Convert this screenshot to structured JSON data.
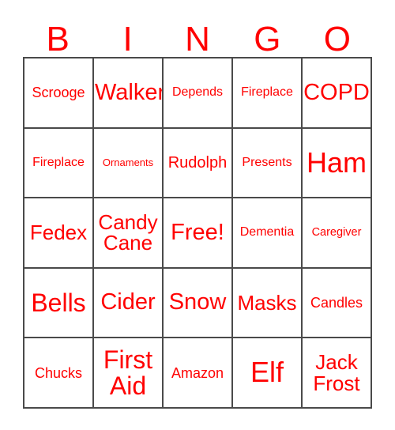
{
  "card": {
    "title": "BINGO",
    "text_color": "#ff0000",
    "grid_line_color": "#4a4a4a",
    "background_color": "#ffffff",
    "header": {
      "letters": [
        "B",
        "I",
        "N",
        "G",
        "O"
      ]
    },
    "columns": 5,
    "rows": 5,
    "free_space": "Free!",
    "cells": [
      [
        {
          "label": "Scrooge",
          "size": "fs-m"
        },
        {
          "label": "Walker",
          "size": "fs-xxl"
        },
        {
          "label": "Depends",
          "size": "fs-s"
        },
        {
          "label": "Fireplace",
          "size": "fs-s"
        },
        {
          "label": "COPD",
          "size": "fs-xxl"
        }
      ],
      [
        {
          "label": "Fireplace",
          "size": "fs-s"
        },
        {
          "label": "Ornaments",
          "size": "fs-xxs"
        },
        {
          "label": "Rudolph",
          "size": "fs-ml"
        },
        {
          "label": "Presents",
          "size": "fs-s"
        },
        {
          "label": "Ham",
          "size": "fs-4xl"
        }
      ],
      [
        {
          "label": "Fedex",
          "size": "fs-xl"
        },
        {
          "label": "Candy\nCane",
          "size": "fs-xl"
        },
        {
          "label": "Free!",
          "size": "fs-xxl"
        },
        {
          "label": "Dementia",
          "size": "fs-s"
        },
        {
          "label": "Caregiver",
          "size": "fs-xs"
        }
      ],
      [
        {
          "label": "Bells",
          "size": "fs-3xl"
        },
        {
          "label": "Cider",
          "size": "fs-xxl"
        },
        {
          "label": "Snow",
          "size": "fs-xxl"
        },
        {
          "label": "Masks",
          "size": "fs-xl"
        },
        {
          "label": "Candles",
          "size": "fs-m"
        }
      ],
      [
        {
          "label": "Chucks",
          "size": "fs-m"
        },
        {
          "label": "First\nAid",
          "size": "fs-3xl"
        },
        {
          "label": "Amazon",
          "size": "fs-m"
        },
        {
          "label": "Elf",
          "size": "fs-4xl"
        },
        {
          "label": "Jack\nFrost",
          "size": "fs-xl"
        }
      ]
    ]
  }
}
